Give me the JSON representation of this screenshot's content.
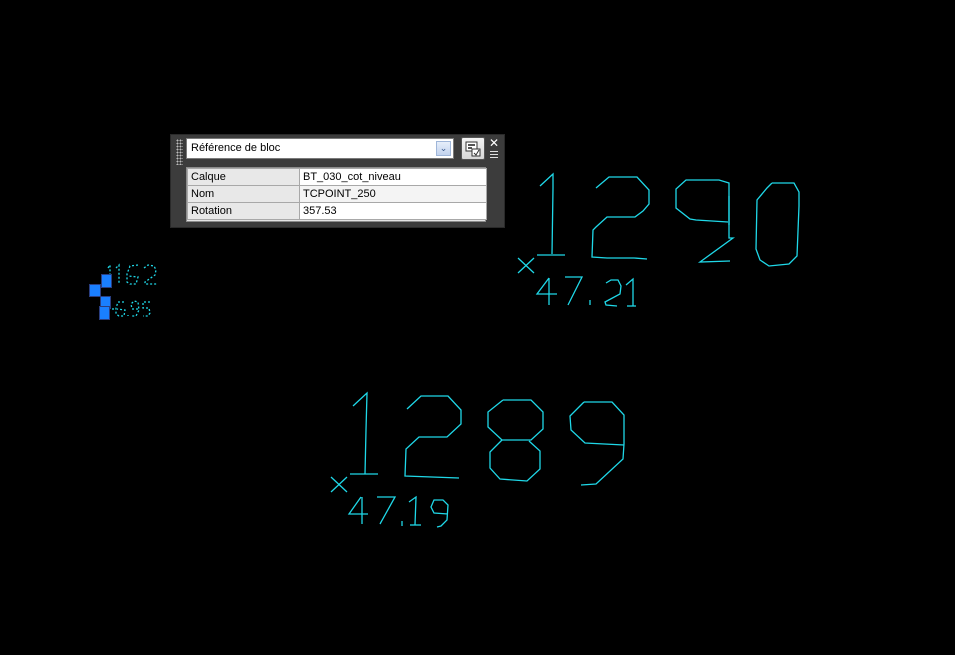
{
  "quick_properties": {
    "object_type": "Référence de bloc",
    "dropdown_arrow": "chevron-down-icon",
    "toggle_icon": "quick-properties-toggle-icon",
    "close_icon": "close-icon",
    "menu_icon": "options-menu-icon",
    "properties": [
      {
        "label": "Calque",
        "value": "BT_030_cot_niveau"
      },
      {
        "label": "Nom",
        "value": "TCPOINT_250"
      },
      {
        "label": "Rotation",
        "value": "357.53"
      }
    ]
  },
  "drawing": {
    "text_color": "#1fd8e8",
    "grip_color": "#1a7fff",
    "points": [
      {
        "number": "1290",
        "elevation": "47.21"
      },
      {
        "number": "1289",
        "elevation": "47.19"
      },
      {
        "number": "1162",
        "elevation": "46.95",
        "selected": true
      }
    ]
  }
}
